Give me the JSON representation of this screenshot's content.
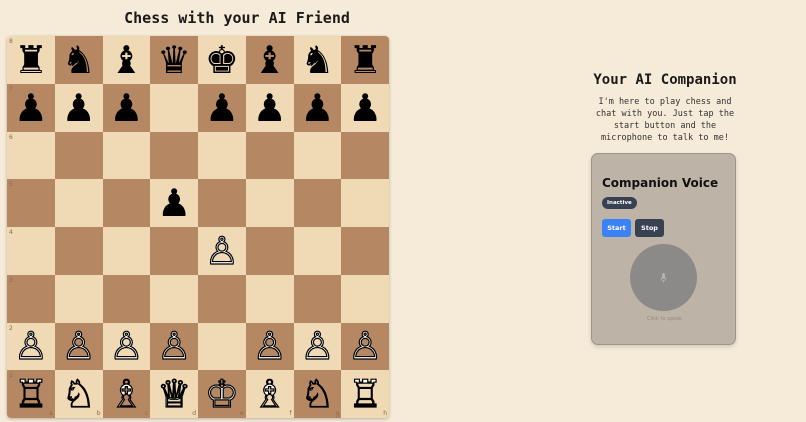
{
  "title": "Chess with your AI Friend",
  "board": {
    "ranks": [
      [
        "♜",
        "♞",
        "♝",
        "♛",
        "♚",
        "♝",
        "♞",
        "♜"
      ],
      [
        "♟",
        "♟",
        "♟",
        "",
        "♟",
        "♟",
        "♟",
        "♟"
      ],
      [
        "",
        "",
        "",
        "",
        "",
        "",
        "",
        ""
      ],
      [
        "",
        "",
        "",
        "♟",
        "",
        "",
        "",
        ""
      ],
      [
        "",
        "",
        "",
        "",
        "♙",
        "",
        "",
        ""
      ],
      [
        "",
        "",
        "",
        "",
        "",
        "",
        "",
        ""
      ],
      [
        "♙",
        "♙",
        "♙",
        "♙",
        "",
        "♙",
        "♙",
        "♙"
      ],
      [
        "♖",
        "♘",
        "♗",
        "♕",
        "♔",
        "♗",
        "♘",
        "♖"
      ]
    ],
    "rank_labels": [
      "8",
      "7",
      "6",
      "5",
      "4",
      "3",
      "2",
      "1"
    ],
    "file_labels": [
      "a",
      "b",
      "c",
      "d",
      "e",
      "f",
      "g",
      "h"
    ],
    "light_color": "#f0d9b5",
    "dark_color": "#b58863"
  },
  "companion": {
    "title": "Your AI Companion",
    "description": "I'm here to play chess and chat with you. Just tap the start button and the microphone to talk to me!"
  },
  "voice": {
    "title": "Companion Voice",
    "status": "Inactive",
    "start_label": "Start",
    "stop_label": "Stop",
    "mic_caption": "Click to speak",
    "mic_icon": "microphone-icon"
  },
  "colors": {
    "start_button": "#3b82f6",
    "stop_button": "#374151",
    "background": "#f6ead8"
  }
}
